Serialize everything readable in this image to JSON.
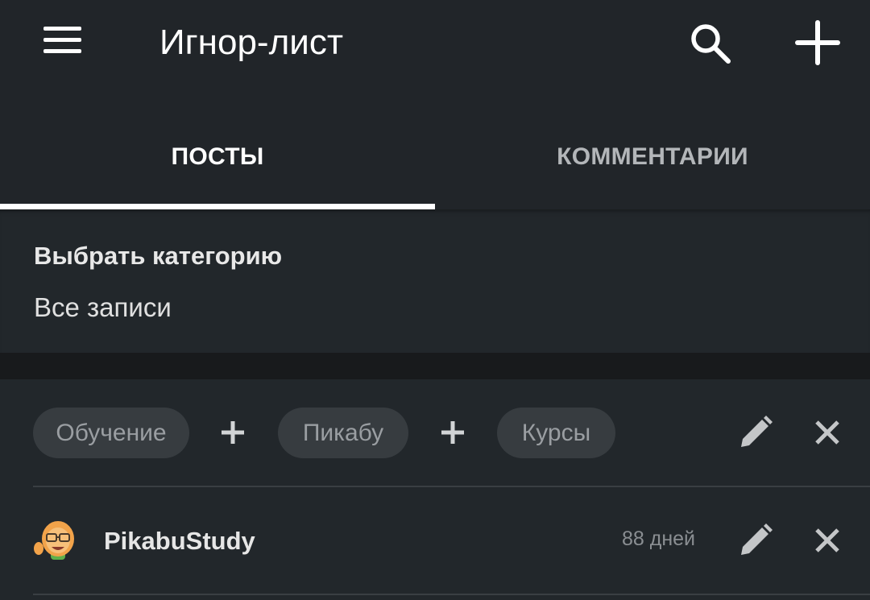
{
  "header": {
    "title": "Игнор-лист",
    "icons": {
      "menu": "menu-icon",
      "search": "search-icon",
      "add": "plus-icon"
    }
  },
  "tabs": [
    {
      "label": "ПОСТЫ",
      "active": true
    },
    {
      "label": "КОММЕНТАРИИ",
      "active": false
    }
  ],
  "category": {
    "label": "Выбрать категорию",
    "value": "Все записи"
  },
  "rules": [
    {
      "type": "tags",
      "tags": [
        "Обучение",
        "Пикабу",
        "Курсы"
      ]
    },
    {
      "type": "user",
      "username": "PikabuStudy",
      "age": "88 дней"
    }
  ],
  "colors": {
    "background": "#212529",
    "panel": "#22272b",
    "chip": "#373c40",
    "chip_text": "#9a9ea2",
    "icon_muted": "#c4c6c8",
    "active_tab": "#ffffff",
    "inactive_tab": "#b3b6b9"
  }
}
